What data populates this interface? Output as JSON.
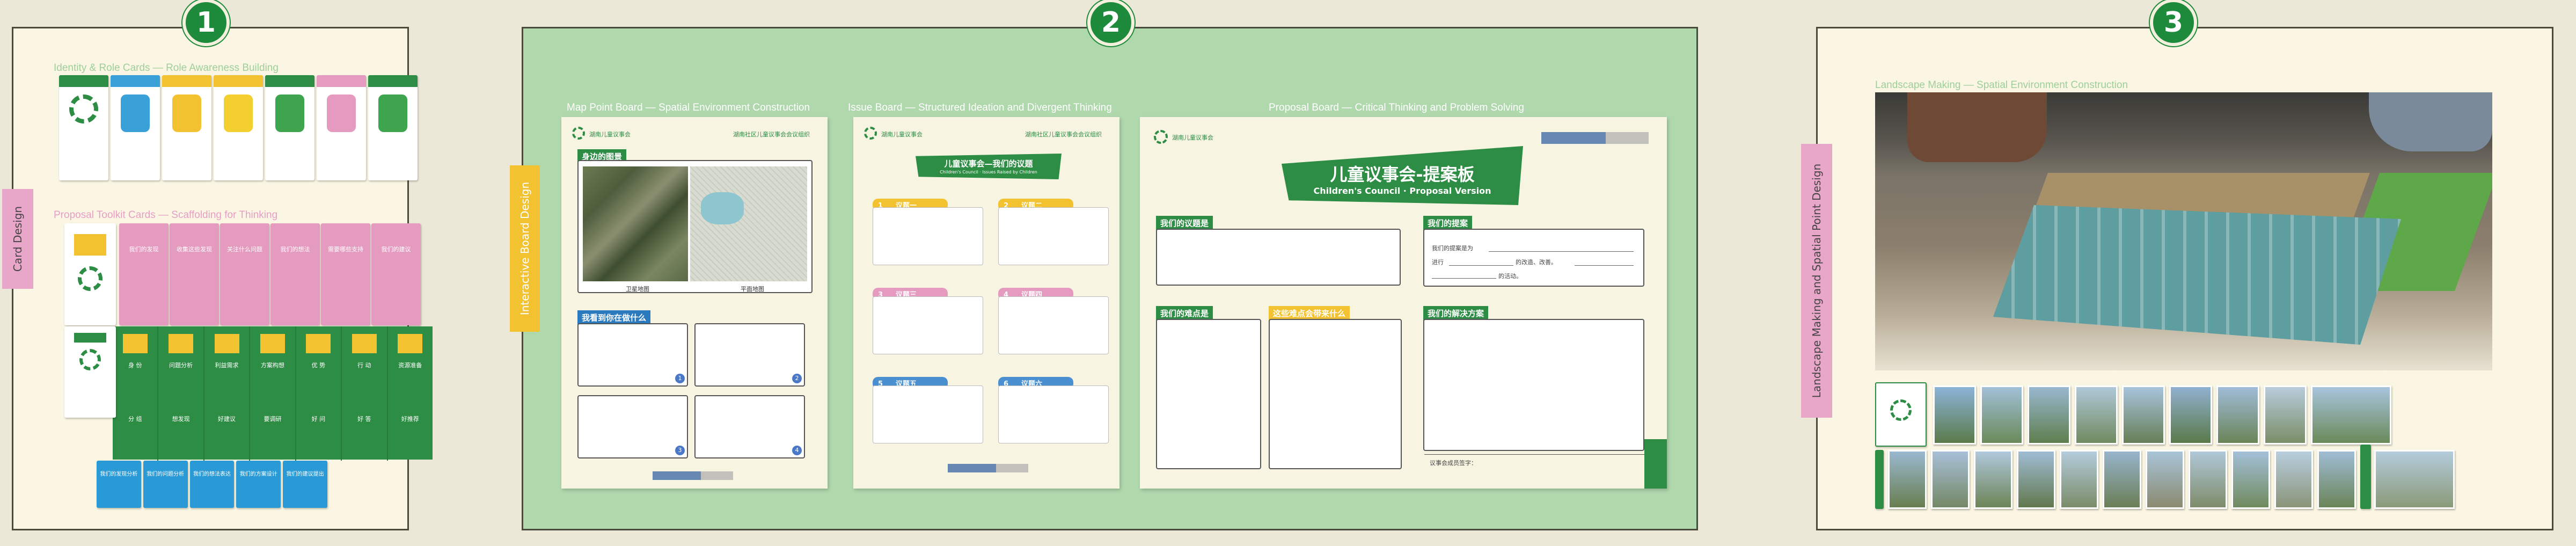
{
  "badges": [
    "1",
    "2",
    "3"
  ],
  "side_tabs": {
    "card_design": "Card Design",
    "interactive_board": "Interactive Board Design",
    "landscape": "Landscape Making and Spatial Point Design"
  },
  "section1": {
    "identity_label": "Identity & Role Cards — Role Awareness Building",
    "toolkit_label": "Proposal Toolkit Cards — Scaffolding for Thinking",
    "toolkit_titles": [
      "我们的发现",
      "收集这些发现",
      "关注什么问题",
      "我们的想法",
      "需要哪些支持",
      "我们的建议"
    ],
    "green_card_labels": [
      "身 份",
      "问题分析",
      "利益需求",
      "方案构想",
      "优 势",
      "行 动",
      "资源准备"
    ],
    "green_row2": [
      "分 组",
      "想发现",
      "好建议",
      "要调研",
      "好 问",
      "好 答",
      "好推荐"
    ],
    "blue_card_labels": [
      "我们的发现分析",
      "我们的问题分析",
      "我们的想法表达",
      "我们的方案设计",
      "我们的建议提出"
    ]
  },
  "section2": {
    "map_label": "Map Point Board — Spatial Environment Construction",
    "issue_label": "Issue Board — Structured Ideation and Divergent Thinking",
    "proposal_label": "Proposal Board — Critical Thinking and Problem Solving",
    "map_board": {
      "org": "湖南儿童议事会",
      "org_right": "湖南社区儿童议事会会议组织",
      "section_a": "身边的图景",
      "satellite_caption": "卫星地图",
      "plan_caption": "平面地图",
      "section_b": "我看到你在做什么",
      "nums": [
        "1",
        "2",
        "3",
        "4"
      ]
    },
    "issue_board": {
      "org": "湖南儿童议事会",
      "org_right": "湖南社区儿童议事会会议组织",
      "title": "儿童议事会—我们的议题",
      "subtitle": "Children's Council · Issues Raised by Children",
      "issues": [
        {
          "num": "1",
          "label": "议题一"
        },
        {
          "num": "2",
          "label": "议题二"
        },
        {
          "num": "3",
          "label": "议题三"
        },
        {
          "num": "4",
          "label": "议题四"
        },
        {
          "num": "5",
          "label": "议题五"
        },
        {
          "num": "6",
          "label": "议题六"
        }
      ]
    },
    "proposal_board": {
      "org": "湖南儿童议事会",
      "title": "儿童议事会-提案板",
      "subtitle": "Children's Council · Proposal Version",
      "h1": "我们的议题是",
      "h2": "我们的提案",
      "h3": "我们的难点是",
      "h4": "这些难点会带来什么",
      "h5": "我们的解决方案",
      "prop_line1": "我们的提案是为",
      "prop_line2": "进行",
      "prop_line3": "的改造、改善。",
      "prop_line4": "的活动。",
      "footer": "议事会成员签字："
    }
  },
  "section3": {
    "label": "Landscape Making — Spatial Environment Construction"
  },
  "colors": {
    "green": "#2e8d45",
    "badge": "#1e8a3c",
    "pink": "#e59bbf",
    "yellow": "#f3c230",
    "blue": "#2a9ad6",
    "mid_panel": "#b0d8ad"
  }
}
